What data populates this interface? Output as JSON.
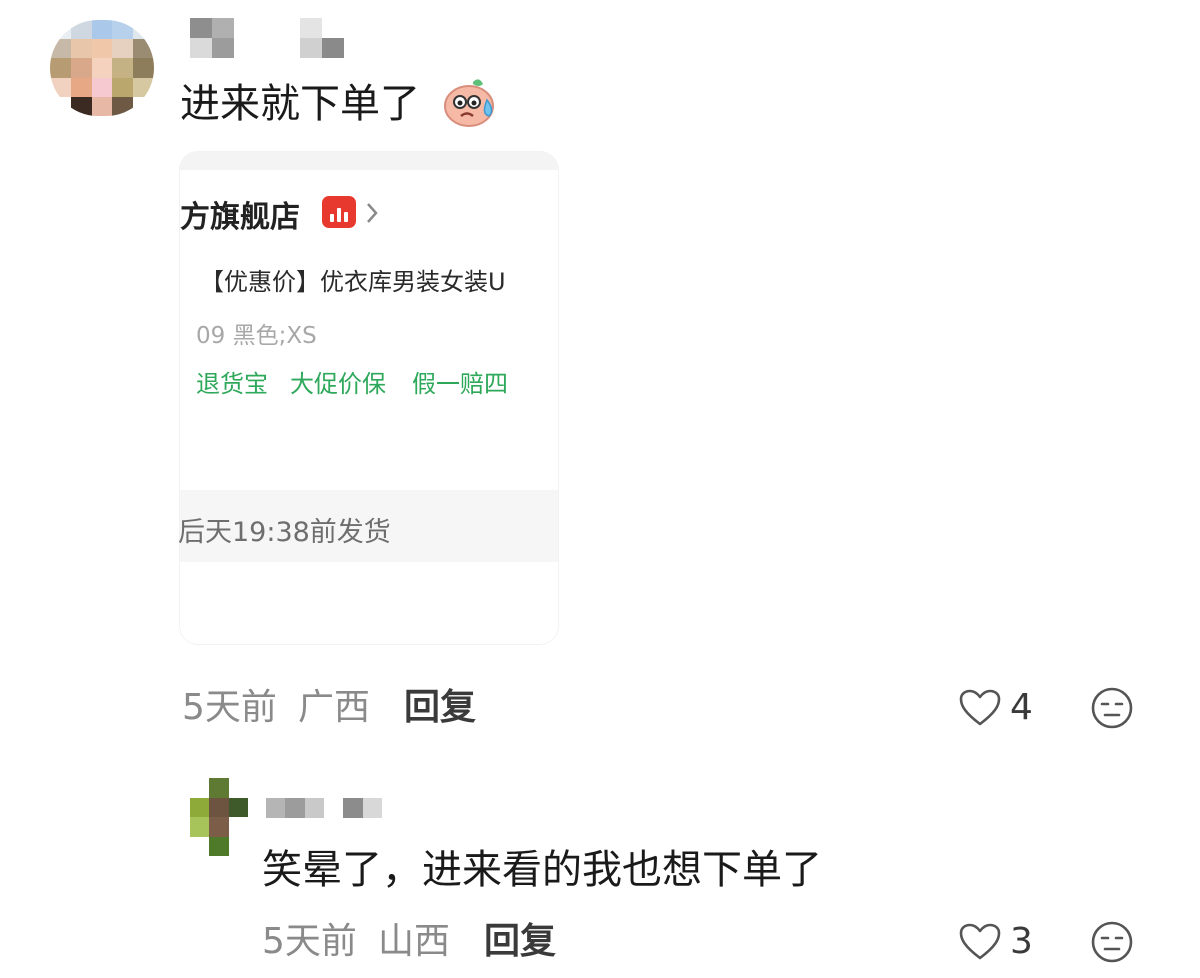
{
  "comments": [
    {
      "text": "进来就下单了",
      "emoji_icon": "sweating-face-sticker-icon",
      "time": "5天前",
      "location": "广西",
      "reply_label": "回复",
      "like_count": "4",
      "order_card": {
        "shop_name": "方旗舰店",
        "product_title": "【优惠价】优衣库男装女装U",
        "sku": "09 黑色;XS",
        "tags": [
          "退货宝",
          "大促价保",
          "假一赔四"
        ],
        "shipping": "后天19:38前发货"
      }
    },
    {
      "text": "笑晕了，进来看的我也想下单了",
      "time": "5天前",
      "location": "山西",
      "reply_label": "回复",
      "like_count": "3"
    }
  ],
  "colors": {
    "meta_gray": "#8a8a8a",
    "tag_green": "#2ea85a",
    "badge_red": "#e8392e"
  }
}
